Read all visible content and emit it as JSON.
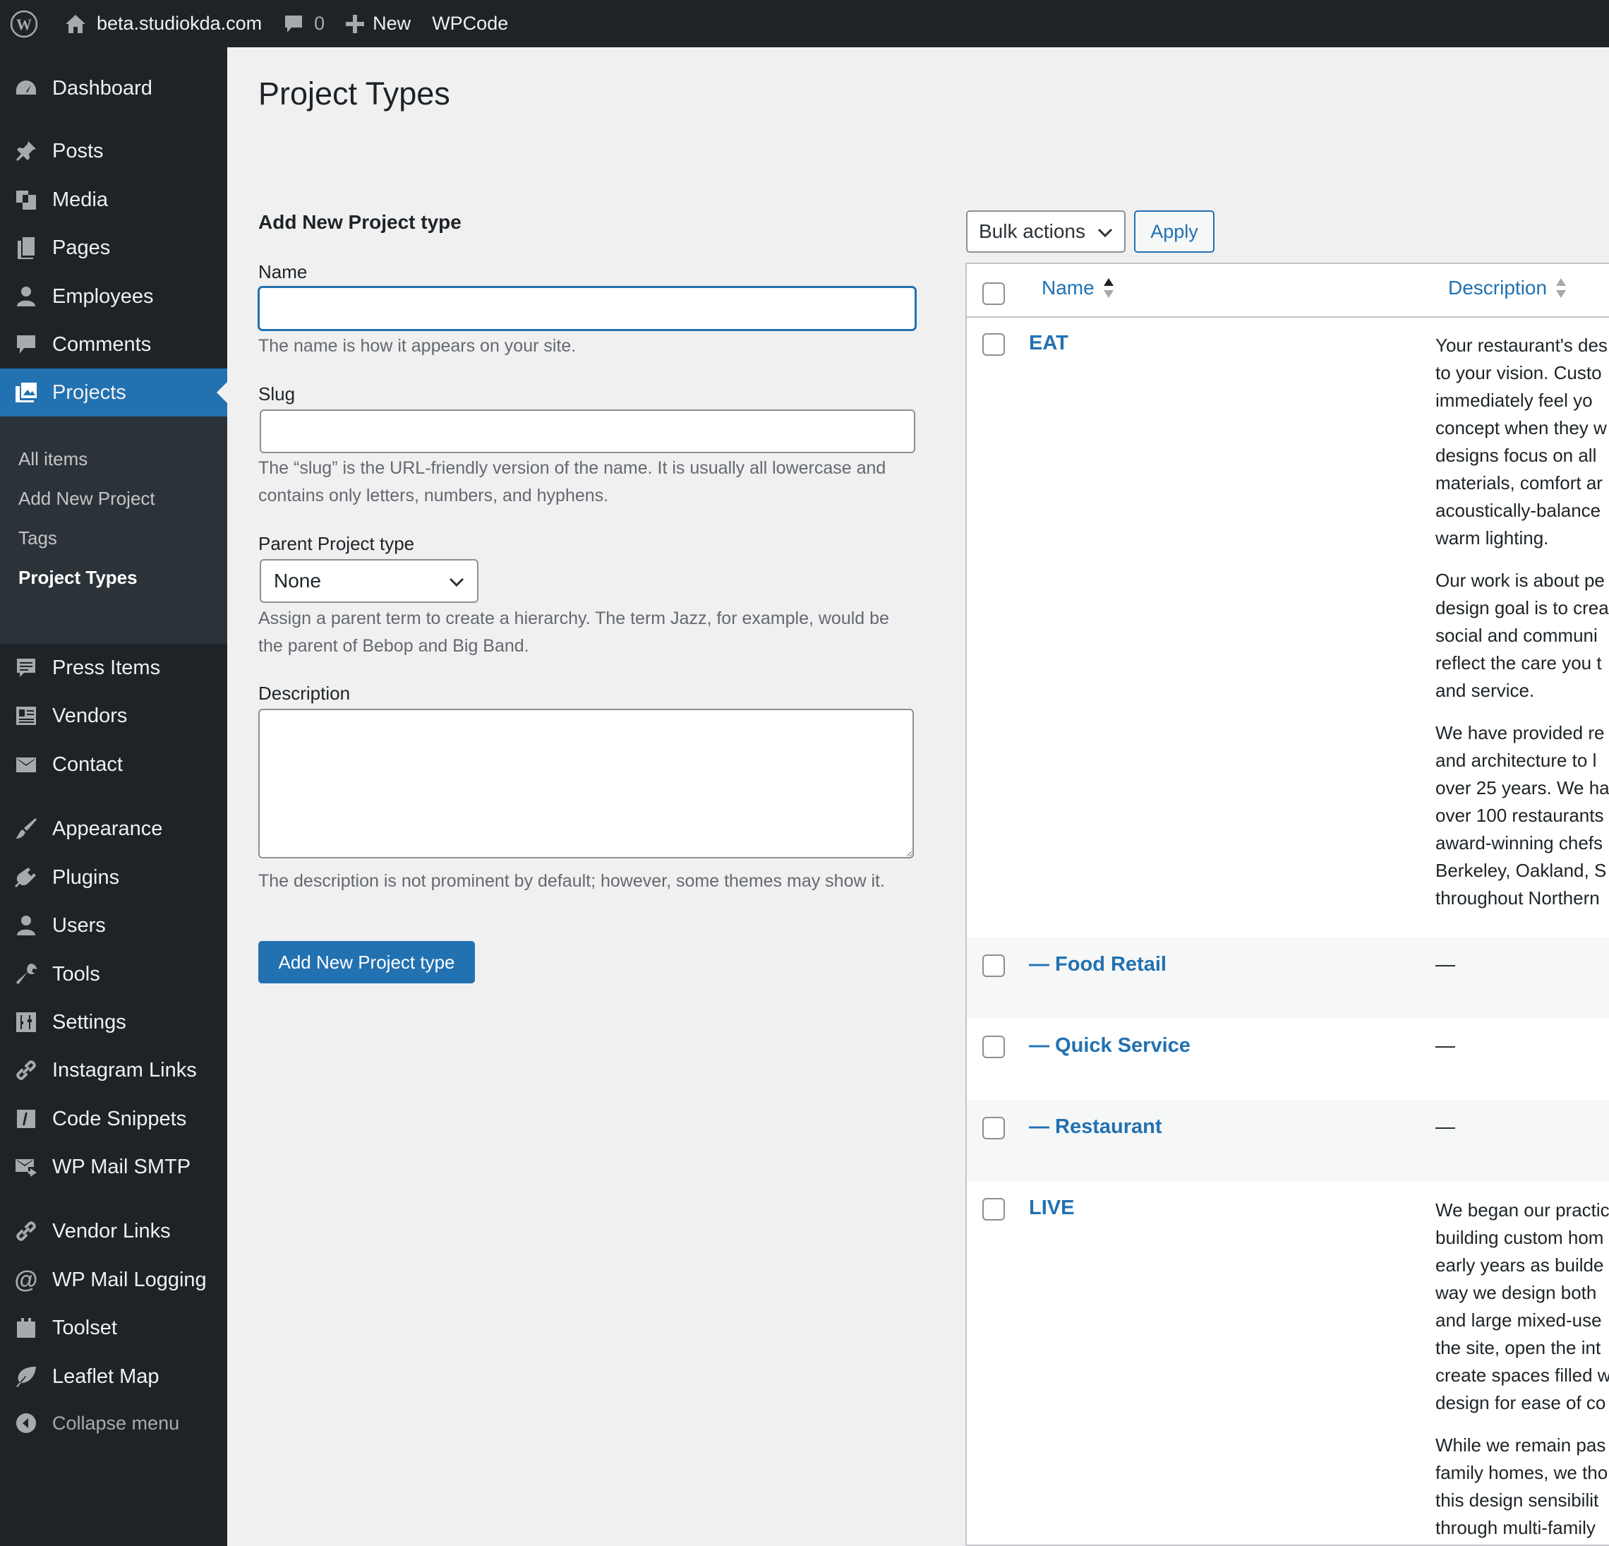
{
  "adminbar": {
    "site_name": "beta.studiokda.com",
    "comments_count": "0",
    "new_label": "New",
    "wpcode_label": "WPCode"
  },
  "sidebar": {
    "items": [
      {
        "label": "Dashboard",
        "icon": "dashboard-icon"
      },
      {
        "label": "Posts",
        "icon": "pin-icon"
      },
      {
        "label": "Media",
        "icon": "media-icon"
      },
      {
        "label": "Pages",
        "icon": "pages-icon"
      },
      {
        "label": "Employees",
        "icon": "user-icon"
      },
      {
        "label": "Comments",
        "icon": "comment-icon"
      },
      {
        "label": "Projects",
        "icon": "portfolio-icon",
        "current": true
      },
      {
        "label": "Press Items",
        "icon": "press-icon"
      },
      {
        "label": "Vendors",
        "icon": "vendors-icon"
      },
      {
        "label": "Contact",
        "icon": "email-icon"
      },
      {
        "label": "Appearance",
        "icon": "brush-icon"
      },
      {
        "label": "Plugins",
        "icon": "plugin-icon"
      },
      {
        "label": "Users",
        "icon": "user-icon"
      },
      {
        "label": "Tools",
        "icon": "wrench-icon"
      },
      {
        "label": "Settings",
        "icon": "settings-icon"
      },
      {
        "label": "Instagram Links",
        "icon": "link-icon"
      },
      {
        "label": "Code Snippets",
        "icon": "code-icon"
      },
      {
        "label": "WP Mail SMTP",
        "icon": "mail-send-icon"
      },
      {
        "label": "Vendor Links",
        "icon": "link-icon"
      },
      {
        "label": "WP Mail Logging",
        "icon": "at-icon"
      },
      {
        "label": "Toolset",
        "icon": "toolset-icon"
      },
      {
        "label": "Leaflet Map",
        "icon": "leaf-icon"
      }
    ],
    "submenu": [
      "All items",
      "Add New Project",
      "Tags",
      "Project Types"
    ],
    "collapse_label": "Collapse menu"
  },
  "page": {
    "title": "Project Types"
  },
  "form": {
    "title": "Add New Project type",
    "name_label": "Name",
    "name_value": "",
    "name_help": "The name is how it appears on your site.",
    "slug_label": "Slug",
    "slug_value": "",
    "slug_help": "The “slug” is the URL-friendly version of the name. It is usually all lowercase and contains only letters, numbers, and hyphens.",
    "parent_label": "Parent Project type",
    "parent_selected": "None",
    "parent_help": "Assign a parent term to create a hierarchy. The term Jazz, for example, would be the parent of Bebop and Big Band.",
    "description_label": "Description",
    "description_value": "",
    "description_help": "The description is not prominent by default; however, some themes may show it.",
    "submit_label": "Add New Project type"
  },
  "table": {
    "bulk_actions_label": "Bulk actions",
    "apply_label": "Apply",
    "columns": [
      "Name",
      "Description"
    ],
    "rows": [
      {
        "name": "EAT",
        "description_lines": [
          [
            "Your restaurant's des",
            "to your vision. Custo",
            "immediately  feel  yo",
            "concept when they w",
            "designs focus on all",
            "materials, comfort ar",
            "acoustically-balance",
            "warm lighting."
          ],
          [
            "Our work is about pe",
            "design goal is to crea",
            " social and communi",
            "reflect the care you t",
            "and service."
          ],
          [
            "We have provided re",
            "and  architecture to l",
            "over  25 years. We ha",
            "over 100 restaurants",
            "award-winning chefs",
            "Berkeley, Oakland, S",
            "throughout Northern"
          ]
        ]
      },
      {
        "name": "— Food Retail",
        "description": "—"
      },
      {
        "name": "— Quick Service",
        "description": "—"
      },
      {
        "name": "— Restaurant",
        "description": "—"
      },
      {
        "name": "LIVE",
        "description_lines": [
          [
            "We began our practic",
            "building custom hom",
            "early years as builde",
            "way we design both",
            "and large mixed-use",
            "the site, open the int",
            "create spaces filled w",
            "design for ease of co"
          ],
          [
            "While we remain pas",
            "family homes, we tho",
            "this design sensibilit",
            "through multi-family"
          ]
        ]
      }
    ]
  },
  "colors": {
    "accent": "#2271b1",
    "adminbar_bg": "#1d2327",
    "submenu_bg": "#2c3338",
    "page_bg": "#f0f0f1"
  }
}
